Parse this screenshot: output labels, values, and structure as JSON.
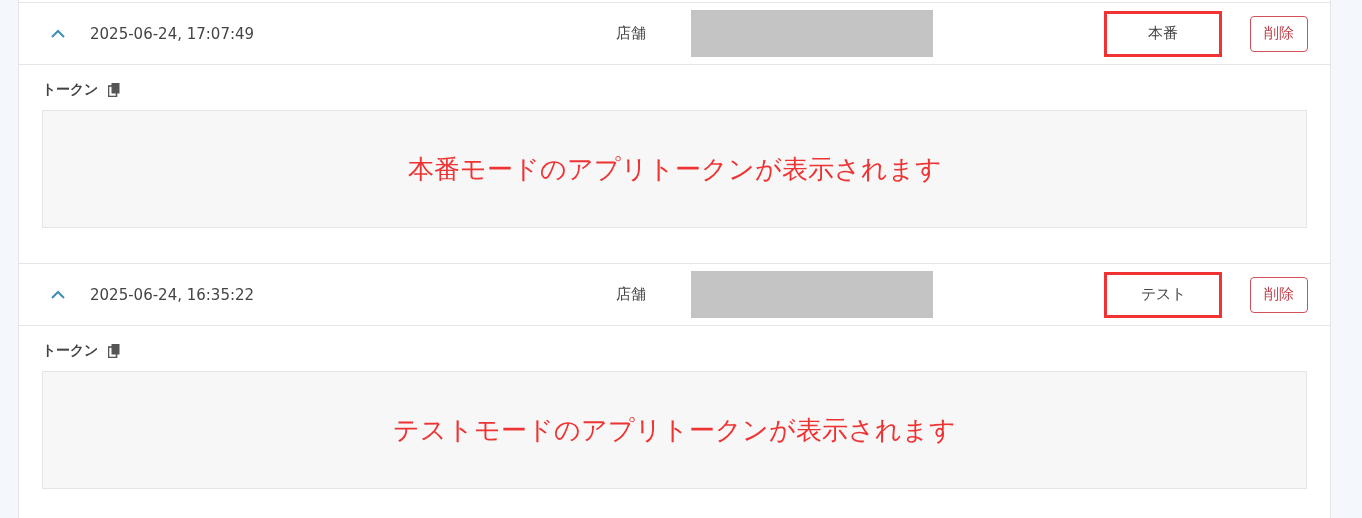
{
  "entries": [
    {
      "expanded": true,
      "timestamp": "2025-06-24, 17:07:49",
      "store_label": "店舗",
      "mode": {
        "label": "本番",
        "highlighted": true
      },
      "delete_button": "削除",
      "token_label": "トークン",
      "token_text": "本番モードのアプリトークンが表示されます"
    },
    {
      "expanded": true,
      "timestamp": "2025-06-24, 16:35:22",
      "store_label": "店舗",
      "mode": {
        "label": "テスト",
        "highlighted": true
      },
      "delete_button": "削除",
      "token_label": "トークン",
      "token_text": "テストモードのアプリトークンが表示されます"
    }
  ]
}
